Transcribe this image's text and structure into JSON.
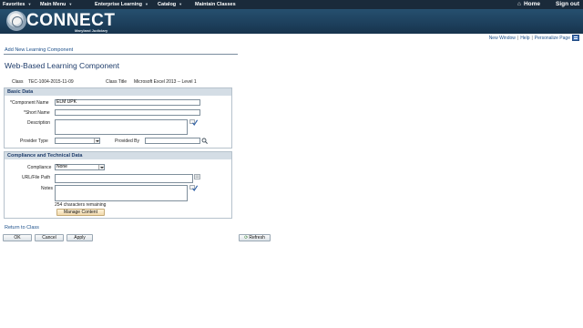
{
  "topnav": {
    "favorites": "Favorites",
    "main_menu": "Main Menu",
    "enterprise_learning": "Enterprise Learning",
    "catalog": "Catalog",
    "maintain_classes": "Maintain Classes",
    "home": "Home",
    "sign_out": "Sign out"
  },
  "brand": {
    "title": "CONNECT",
    "subtitle": "Maryland Judiciary"
  },
  "util_links": {
    "new_window": "New Window",
    "help": "Help",
    "personalize": "Personalize Page",
    "separator": "|"
  },
  "page": {
    "section_link": "Add New Learning Component",
    "title": "Web-Based Learning Component"
  },
  "class_info": {
    "class_label": "Class",
    "class_value": "TEC-1004-2015-11-09",
    "title_label": "Class Title",
    "title_value": "Microsoft Excel 2013 -- Level 1"
  },
  "basic_data": {
    "heading": "Basic Data",
    "component_name_label": "*Component Name",
    "component_name_value": "ELM UPK",
    "short_name_label": "*Short Name",
    "short_name_value": "",
    "description_label": "Description",
    "provider_type_label": "Provider Type",
    "provider_type_value": "",
    "provided_by_label": "Provided By",
    "provided_by_value": ""
  },
  "compliance": {
    "heading": "Compliance and Technical Data",
    "compliance_label": "Compliance",
    "compliance_value": "None",
    "url_label": "URL/File Path",
    "notes_label": "Notes",
    "chars_remaining": "254 characters remaining",
    "manage_content": "Manage Content"
  },
  "footer": {
    "return_link": "Return to Class",
    "ok": "OK",
    "cancel": "Cancel",
    "apply": "Apply",
    "refresh": "Refresh"
  },
  "icons": {
    "home": "home-icon",
    "spell_check": "spell-check-icon",
    "search": "search-icon",
    "refresh": "refresh-icon",
    "menu": "page-menu-icon"
  },
  "colors": {
    "nav_bg": "#1a2a3a",
    "banner_bg": "#1d3f5c",
    "link": "#1b4f8a",
    "title": "#1f3d6b",
    "section_head_bg": "#d4dde5"
  }
}
